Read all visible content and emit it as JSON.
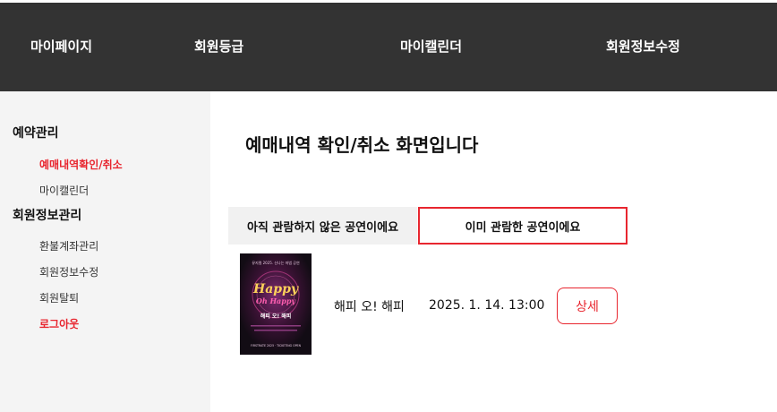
{
  "topnav": {
    "items": [
      {
        "label": "마이페이지"
      },
      {
        "label": "회원등급"
      },
      {
        "label": "마이캘린더"
      },
      {
        "label": "회원정보수정"
      }
    ],
    "background": "#333333"
  },
  "sidebar": {
    "groups": [
      {
        "title": "예약관리",
        "links": [
          {
            "label": "예매내역확인/취소",
            "active": true
          },
          {
            "label": "마이캘린더"
          }
        ]
      },
      {
        "title": "회원정보관리",
        "links": [
          {
            "label": "환불계좌관리"
          },
          {
            "label": "회원정보수정"
          },
          {
            "label": "회원탈퇴"
          },
          {
            "label": "로그아웃"
          }
        ]
      }
    ]
  },
  "main": {
    "title": "예매내역 확인/취소 화면입니다",
    "tabs": [
      {
        "label": "아직 관람하지 않은 공연이에요",
        "selected": false
      },
      {
        "label": "이미 관람한 공연이에요",
        "selected": true
      }
    ],
    "reservations": [
      {
        "poster_icon": "show-poster",
        "poster_text": {
          "top": "뮤지컬 2025. 신나는 마법 공연",
          "headline1": "Happy",
          "headline2": "Oh Happy",
          "korean": "해피 오! 해피",
          "footer": "FIRSTRATE 2025 · TICKETING OPEN"
        },
        "title": "해피 오! 해피",
        "datetime": "2025. 1. 14. 13:00",
        "detail_label": "상세"
      }
    ]
  },
  "colors": {
    "accent": "#e8262f",
    "nav_bg": "#333333",
    "sidebar_bg": "#f4f4f4",
    "tab_inactive_bg": "#f1f1f1"
  }
}
